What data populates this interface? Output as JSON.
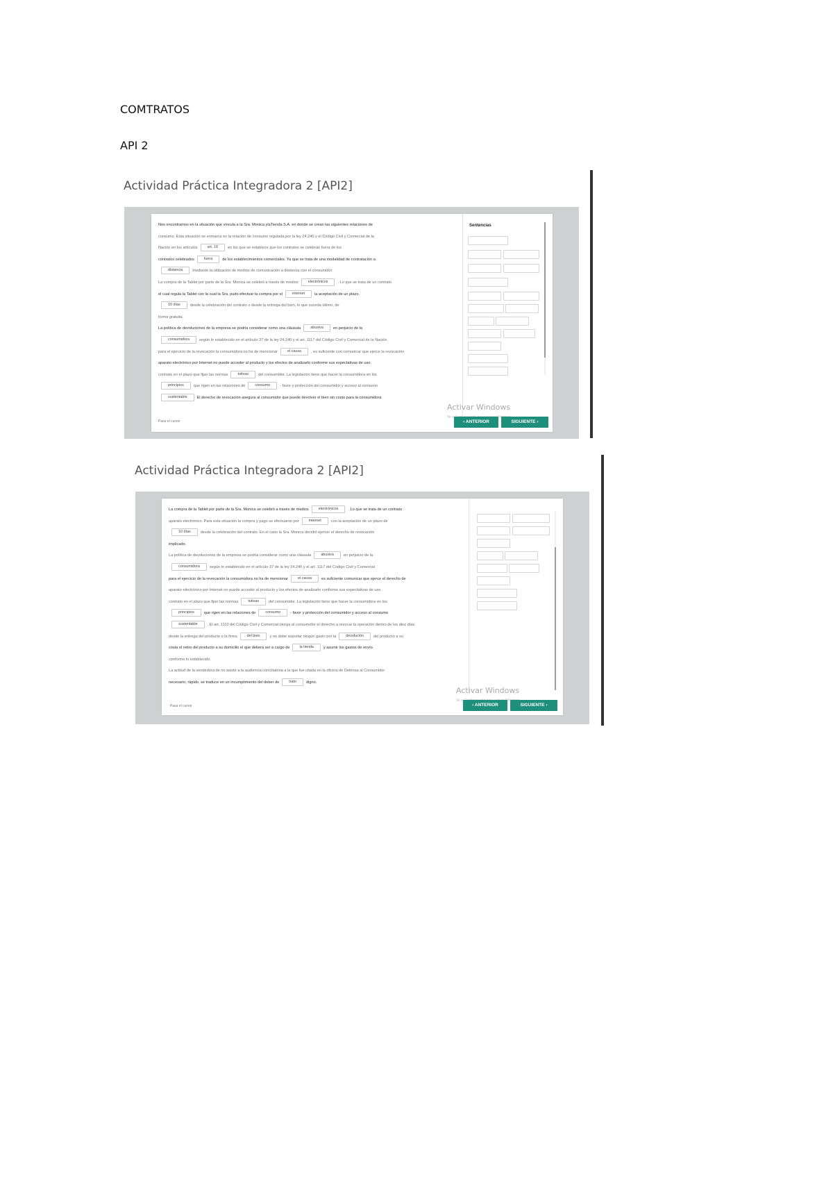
{
  "document": {
    "heading": "COMTRATOS",
    "subheading": "API 2"
  },
  "screenshots": [
    {
      "title": "Actividad Práctica Integradora 2 [API2]",
      "options_title": "Sentencias",
      "prev_label": "ANTERIOR",
      "next_label": "SIGUIENTE",
      "footer_label": "Pasa el cursor",
      "watermark": "Activar Windows",
      "watermark_sub": "Ve a Configuración para activar Windows.",
      "lines": [
        {
          "segments": [
            "Nos encontramos en la situación que vincula a la Sra. Monica ylaTienda S.A. en donde se crean las siguientes relaciones de"
          ]
        },
        {
          "segments": [
            "consumo. Esta situación se enmarca en la relación de consumo regulada por la ley 24.240 y el Código Civil y Comercial de la"
          ]
        },
        {
          "segments": [
            "Nación en los artículos",
            "art. 19",
            "en los que se establece que los contratos se celebran fuera de los"
          ]
        },
        {
          "segments": [
            "contratos celebrados",
            "fuera",
            "de los establecimientos comerciales. Ya que se trata de una modalidad de contratación a"
          ]
        },
        {
          "segments": [
            "",
            "distancia",
            "mediante la utilización de medios de comunicación a distancia con el consumidor"
          ]
        },
        {
          "segments": [
            "La compra de la Tablet por parte de la Sra. Monica se celebró a través de medios",
            "electrónicos",
            ". Lo que se trata de un contrato"
          ]
        },
        {
          "segments": [
            "el cual regula la Tablet con la cual la Sra. pudo efectuar la compra por el",
            "internet",
            "la aceptación de un plazo."
          ]
        },
        {
          "segments": [
            "",
            "10 días",
            "desde la celebración del contrato o desde la entrega del bien, lo que suceda último, de"
          ]
        },
        {
          "segments": [
            "forma gratuita."
          ]
        },
        {
          "segments": [
            "La política de devoluciones de la empresa se podría considerar como una cláusula",
            "abusiva",
            "en perjuicio de la"
          ]
        },
        {
          "segments": [
            "",
            "consumidora",
            "según lo establecido en el artículo 37 de la ley 24.240 y el art. 1117 del Código Civil y Comercial de la Nación"
          ]
        },
        {
          "segments": [
            "para el ejercicio de la revocación la consumidora no ha de mencionar",
            "el causa",
            ", es suficiente con comunicar que ejerce la revocación"
          ]
        },
        {
          "segments": [
            "aparato electrónico por Internet no puede acceder al producto y los efectos de analizarlo conforme sus expectativas de uso."
          ]
        },
        {
          "segments": [
            "contrato en el plazo que fijan las normas",
            "tutivas",
            "del consumidor. La legislación tiene que hacer la consumidora en los"
          ]
        },
        {
          "segments": [
            "",
            "principios",
            "que rigen en las relaciones de",
            "consumo",
            "- favor y protección del consumidor y acceso al consumo"
          ]
        },
        {
          "segments": [
            "",
            "sustentable",
            "El derecho de revocación asegura al consumidor que puede devolver el bien sin costo para la consumidora"
          ]
        }
      ]
    },
    {
      "title": "Actividad Práctica Integradora 2 [API2]",
      "prev_label": "ANTERIOR",
      "next_label": "SIGUIENTE",
      "footer_label": "Pasa el cursor",
      "watermark": "Activar Windows",
      "watermark_sub": "Ve a Configuración para activar Windows.",
      "lines": [
        {
          "segments": [
            "La compra de la Tablet por parte de la Sra. Monica se celebró a través de medios",
            "electrónicos",
            ". Lo que se trata de un contrato"
          ]
        },
        {
          "segments": [
            "aparato electrónico. Para esta situación la compra y pago se efectuaron por",
            "internet",
            "con la aceptación de un plazo de"
          ]
        },
        {
          "segments": [
            "",
            "10 días",
            "desde la celebración del contrato. En el caso la Sra. Monica decidió ejercer el derecho de revocación"
          ]
        },
        {
          "segments": [
            "implicado."
          ]
        },
        {
          "segments": [
            "La política de devoluciones de la empresa se podría considerar como una cláusula",
            "abusiva",
            "en perjuicio de la"
          ]
        },
        {
          "segments": [
            "",
            "consumidora",
            "según lo establecido en el artículo 37 de la ley 24.240 y el art. 1117 del Código Civil y Comercial"
          ]
        },
        {
          "segments": [
            "para el ejercicio de la revocación la consumidora no ha de mencionar",
            "el causa",
            "es suficiente comunicar que ejerce el derecho de"
          ]
        },
        {
          "segments": [
            "aparato electrónico por Internet no puede acceder al producto y los efectos de analizarlo conforme sus expectativas de uso."
          ]
        },
        {
          "segments": [
            "contrato en el plazo que fijan las normas",
            "tutivas",
            "del consumidor. La legislación tiene que hacer la consumidora en los"
          ]
        },
        {
          "segments": [
            "",
            "principios",
            "que rigen en las relaciones de",
            "consumo",
            "- favor y protección del consumidor y acceso al consumo"
          ]
        },
        {
          "segments": [
            "",
            "sustentable",
            ". El art. 1110 del Código Civil y Comercial otorga al consumidor el derecho a revocar la operación dentro de los diez días"
          ]
        },
        {
          "segments": [
            "desde la entrega del producto o la firma",
            "del bien",
            "y no debe soportar ningún gasto por la",
            "devolución",
            "del producto a su"
          ]
        },
        {
          "segments": [
            "costa el retiro del producto a su domicilio el que deberá ser a cargo de",
            "la tienda",
            "y asumir los gastos de envío."
          ]
        },
        {
          "segments": [
            "conforme lo establecido."
          ]
        },
        {
          "segments": [
            "La actitud de la vendedora de no asistir a la audiencia conciliatoria a la que fue citada en la oficina de Defensa al Consumidor"
          ]
        },
        {
          "segments": [
            "necesario, rápido, se traduce en un incumplimiento del deber de",
            "trato",
            "digno."
          ]
        }
      ]
    }
  ]
}
